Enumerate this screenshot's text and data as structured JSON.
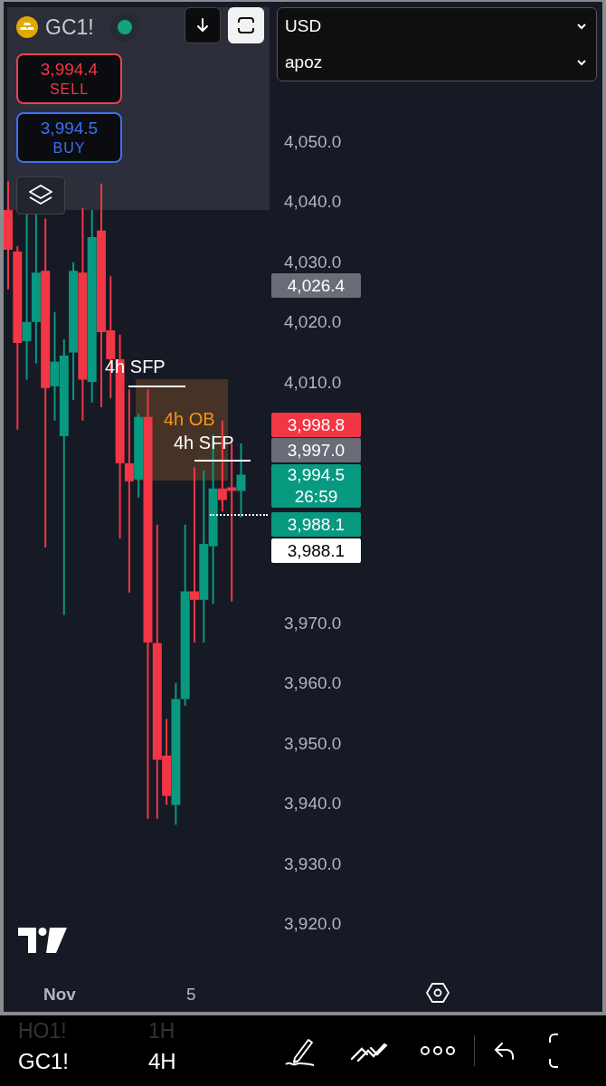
{
  "symbol": {
    "name": "GC1!",
    "market_open": true
  },
  "trade": {
    "sell": {
      "price": "3,994.4",
      "label": "SELL"
    },
    "buy": {
      "price": "3,994.5",
      "label": "BUY"
    }
  },
  "selectors": [
    {
      "value": "USD"
    },
    {
      "value": "apoz"
    }
  ],
  "annotations": [
    {
      "kind": "sfp",
      "text": "4h SFP"
    },
    {
      "kind": "ob",
      "text": "4h OB"
    },
    {
      "kind": "sfp",
      "text": "4h SFP"
    }
  ],
  "chart_data": {
    "type": "candlestick",
    "ylim": [
      3920,
      4050
    ],
    "ohlc": [
      [
        4038.4,
        4043.2,
        4025.2,
        4031.8
      ],
      [
        4031.5,
        4032.4,
        4001.9,
        4016.3
      ],
      [
        4016.6,
        4038.0,
        4010.2,
        4019.8
      ],
      [
        4019.8,
        4037.8,
        4012.9,
        4028.0
      ],
      [
        4028.3,
        4037.0,
        3982.3,
        4008.8
      ],
      [
        4009.1,
        4021.4,
        4003.4,
        4013.2
      ],
      [
        4000.8,
        4016.9,
        3971.1,
        4014.2
      ],
      [
        4014.7,
        4029.7,
        4006.8,
        4028.3
      ],
      [
        4028.0,
        4038.7,
        4003.4,
        4010.2
      ],
      [
        4009.8,
        4038.4,
        4006.4,
        4033.9
      ],
      [
        4035.0,
        4042.8,
        4005.6,
        4018.1
      ],
      [
        4018.4,
        4027.4,
        4007.1,
        4013.6
      ],
      [
        4013.6,
        4017.7,
        3983.8,
        3996.3
      ],
      [
        3996.3,
        4008.6,
        3974.8,
        3993.3
      ],
      [
        3993.6,
        4004.5,
        3990.6,
        4004.0
      ],
      [
        4004.0,
        4008.6,
        3937.2,
        3966.5
      ],
      [
        3966.4,
        3986.1,
        3937.2,
        3947.0
      ],
      [
        3947.7,
        3953.8,
        3939.5,
        3941.0
      ],
      [
        3939.5,
        3959.8,
        3936.2,
        3957.1
      ],
      [
        3957.1,
        3986.1,
        3956.0,
        3975.0
      ],
      [
        3975.0,
        3995.6,
        3966.5,
        3973.6
      ],
      [
        3973.6,
        3995.1,
        3966.5,
        3982.9
      ],
      [
        3982.5,
        4001.1,
        3972.9,
        3992.1
      ],
      [
        3992.1,
        4003.4,
        3988.3,
        3990.2
      ],
      [
        3992.3,
        3999.6,
        3973.3,
        3991.7
      ],
      [
        3991.7,
        3999.6,
        3987.3,
        3994.4
      ]
    ],
    "yticks": [
      {
        "value": 4050,
        "label": "4,050.0"
      },
      {
        "value": 4040,
        "label": "4,040.0"
      },
      {
        "value": 4030,
        "label": "4,030.0"
      },
      {
        "value": 4020,
        "label": "4,020.0"
      },
      {
        "value": 4010,
        "label": "4,010.0"
      },
      {
        "value": 3970,
        "label": "3,970.0"
      },
      {
        "value": 3960,
        "label": "3,960.0"
      },
      {
        "value": 3950,
        "label": "3,950.0"
      },
      {
        "value": 3940,
        "label": "3,940.0"
      },
      {
        "value": 3930,
        "label": "3,930.0"
      },
      {
        "value": 3920,
        "label": "3,920.0"
      }
    ]
  },
  "price_labels": [
    {
      "text": "4,026.4",
      "color": "#6a6d78"
    },
    {
      "text": "3,998.8",
      "color": "#f23645"
    },
    {
      "text": "3,997.0",
      "color": "#6a6d78"
    },
    {
      "text": "3,994.5",
      "countdown": "26:59",
      "color": "#089981"
    },
    {
      "text": "3,988.1",
      "color": "#089981"
    },
    {
      "text": "3,988.1",
      "color": "#ffffff"
    }
  ],
  "time_axis": [
    {
      "text": "Nov",
      "bold": true
    },
    {
      "text": "5",
      "bold": false
    }
  ],
  "bottom_bar": {
    "symbols": [
      {
        "text": "HO1!",
        "selected": false
      },
      {
        "text": "GC1!",
        "selected": true
      }
    ],
    "intervals": [
      {
        "text": "1H",
        "selected": false
      },
      {
        "text": "4H",
        "selected": true
      }
    ]
  }
}
